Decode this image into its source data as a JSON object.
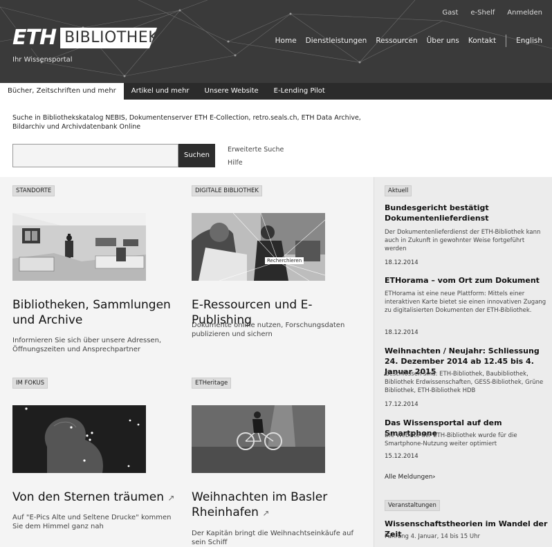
{
  "header": {
    "utility": [
      "Gast",
      "e-Shelf",
      "Anmelden"
    ],
    "logo_eth": "ETH",
    "logo_bib": "BIBLIOTHEK",
    "tagline": "Ihr Wissensportal",
    "nav": [
      "Home",
      "Dienstleistungen",
      "Ressourcen",
      "Über uns",
      "Kontakt"
    ],
    "lang": "English"
  },
  "tabs": [
    "Bücher, Zeitschriften und mehr",
    "Artikel und mehr",
    "Unsere Website",
    "E-Lending Pilot"
  ],
  "search": {
    "description": "Suche in Bibliothekskatalog NEBIS, Dokumentenserver ETH E-Collection, retro.seals.ch, ETH Data Archive, Bildarchiv und Archivdatenbank Online",
    "button": "Suchen",
    "advanced": "Erweiterte Suche",
    "help": "Hilfe"
  },
  "cards": {
    "standorte": {
      "badge": "STANDORTE",
      "title": "Bibliotheken, Sammlungen und Archive",
      "text": "Informieren Sie sich über unsere Adressen, Öffnungszeiten und Ansprechpartner"
    },
    "digital": {
      "badge": "DIGITALE BIBLIOTHEK",
      "image_label": "Recherchieren",
      "title": "E-Ressourcen und E-Publishing",
      "text": "Dokumente online nutzen, Forschungsdaten publizieren und sichern"
    },
    "fokus": {
      "badge": "IM FOKUS",
      "title": "Von den Sternen träumen",
      "text": "Auf \"E-Pics Alte und Seltene Drucke\" kommen Sie dem Himmel ganz nah"
    },
    "heritage": {
      "badge": "ETHeritage",
      "title": "Weihnachten im Basler Rheinhafen",
      "text": "Der Kapitän bringt die Weihnachtseinkäufe auf sein Schiff"
    }
  },
  "sidebar": {
    "aktuell": "Aktuell",
    "news": [
      {
        "title": "Bundesgericht bestätigt Dokumentenlieferdienst",
        "text": "Der Dokumentenlieferdienst der ETH-Bibliothek kann auch in Zukunft in gewohnter Weise fortgeführt werden",
        "date": "18.12.2014"
      },
      {
        "title": "ETHorama – vom Ort zum Dokument",
        "text": "ETHorama ist eine neue Plattform: Mittels einer interaktiven Karte bietet sie einen innovativen Zugang zu digitalisierten Dokumenten der ETH-Bibliothek.",
        "date": "18.12.2014"
      },
      {
        "title": "Weihnachten / Neujahr: Schliessung 24. Dezember 2014 ab 12.45 bis 4. Januar 2015",
        "text": "Geschlossen sind: ETH-Bibliothek, Baubibliothek, Bibliothek Erdwissenschaften, GESS-Bibliothek, Grüne Bibliothek, ETH-Bibliothek HDB",
        "date": "17.12.2014"
      },
      {
        "title": "Das Wissensportal auf dem Smartphone",
        "text": "Die Website der ETH-Bibliothek wurde für die Smartphone-Nutzung weiter optimiert",
        "date": "15.12.2014"
      }
    ],
    "all_news": "Alle Meldungen",
    "events_badge": "Veranstaltungen",
    "event_title": "Wissenschaftstheorien im Wandel der Zeit",
    "event_text": "Führung 4. Januar, 14 bis 15 Uhr"
  }
}
